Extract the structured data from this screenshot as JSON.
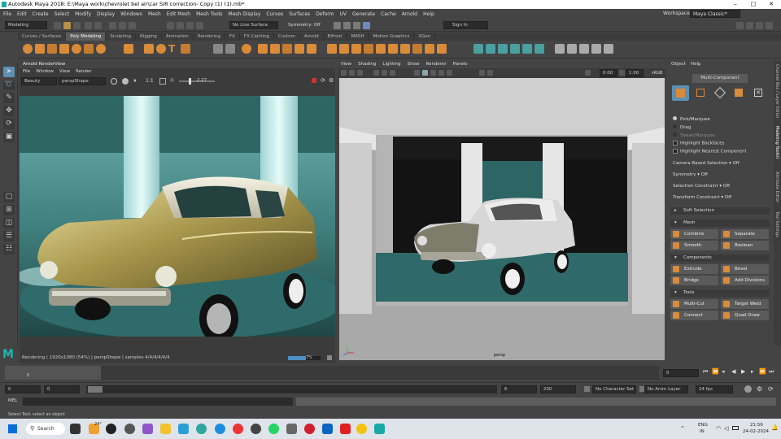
{
  "titlebar": {
    "title": "Autodesk Maya 2018: E:\\Maya work\\chevrolet bel air\\car SIR correction- Copy (1) (1).mb*"
  },
  "menus": [
    "File",
    "Edit",
    "Create",
    "Select",
    "Modify",
    "Display",
    "Windows",
    "Mesh",
    "Edit Mesh",
    "Mesh Tools",
    "Mesh Display",
    "Curves",
    "Surfaces",
    "Deform",
    "UV",
    "Generate",
    "Cache",
    "Arnold",
    "Help"
  ],
  "status": {
    "workspace_label": "Workspace :",
    "workspace_value": "Maya Classic*",
    "menuset": "Modeling",
    "live_surface": "No Live Surface",
    "symmetry": "Symmetry: Off",
    "signin": "Sign In"
  },
  "shelf_tabs": [
    "Curves / Surfaces",
    "Poly Modeling",
    "Sculpting",
    "Rigging",
    "Animation",
    "Rendering",
    "FX",
    "FX Caching",
    "Custom",
    "Arnold",
    "Bifrost",
    "MASH",
    "Motion Graphics",
    "XGen"
  ],
  "shelf_active": "Poly Modeling",
  "renderview": {
    "title": "Arnold RenderView",
    "menus": [
      "File",
      "Window",
      "View",
      "Render"
    ],
    "aov": "Beauty",
    "camera": "perspShape",
    "ratio": "1:1",
    "exposure": "2.27",
    "status": "Rendering ( 1920x1080 (54%) | perspShape | samples 4/4/4/4/4/4",
    "progress_label": "7%"
  },
  "viewport": {
    "menus": [
      "View",
      "Shading",
      "Lighting",
      "Show",
      "Renderer",
      "Panels"
    ],
    "field1": "0.00",
    "field2": "1.00",
    "colorspace": "sRGB",
    "camera_label": "persp"
  },
  "modeling": {
    "tabs": [
      "Object",
      "Help"
    ],
    "multi_component": "Multi-Component",
    "pick_marquee": "Pick/Marquee",
    "drag": "Drag",
    "tweak_marquee": "Tweak/Marquee",
    "highlight_backfaces": "Highlight Backfaces",
    "highlight_nearest": "Highlight Nearest Component",
    "camera_based_selection": "Camera Based Selection",
    "camera_based_value": "Off",
    "symmetry": "Symmetry",
    "symmetry_value": "Off",
    "selection_constraint": "Selection Constraint",
    "selection_constraint_value": "Off",
    "transform_constraint": "Transform Constraint",
    "transform_constraint_value": "Off",
    "soft_selection": "Soft Selection",
    "mesh_header": "Mesh",
    "mesh_buttons": [
      "Combine",
      "Separate",
      "Smooth",
      "Boolean"
    ],
    "components_header": "Components",
    "component_buttons": [
      "Extrude",
      "Bevel",
      "Bridge",
      "Add Divisions"
    ],
    "tools_header": "Tools",
    "tool_buttons": [
      "Multi-Cut",
      "Target Weld",
      "Connect",
      "Quad Draw"
    ],
    "side_tabs": [
      "Channel Box / Layer Editor",
      "Modeling Toolkit",
      "Attribute Editor",
      "Tool Settings"
    ]
  },
  "timeline": {
    "current_frame": "0",
    "tick_0": "0",
    "end_field": "0"
  },
  "range": {
    "start": "0",
    "start2": "0",
    "range_label": "6",
    "end": "6",
    "end2": "200",
    "character_set": "No Character Set",
    "anim_layer": "No Anim Layer",
    "fps": "24 fps"
  },
  "mel": {
    "label": "MEL"
  },
  "helpline": {
    "text": "Select Tool: select an object"
  },
  "taskbar": {
    "search": "Search",
    "weather": "24°",
    "lang1": "ENG",
    "lang2": "IN",
    "time": "21:56",
    "date": "24-02-2024"
  }
}
